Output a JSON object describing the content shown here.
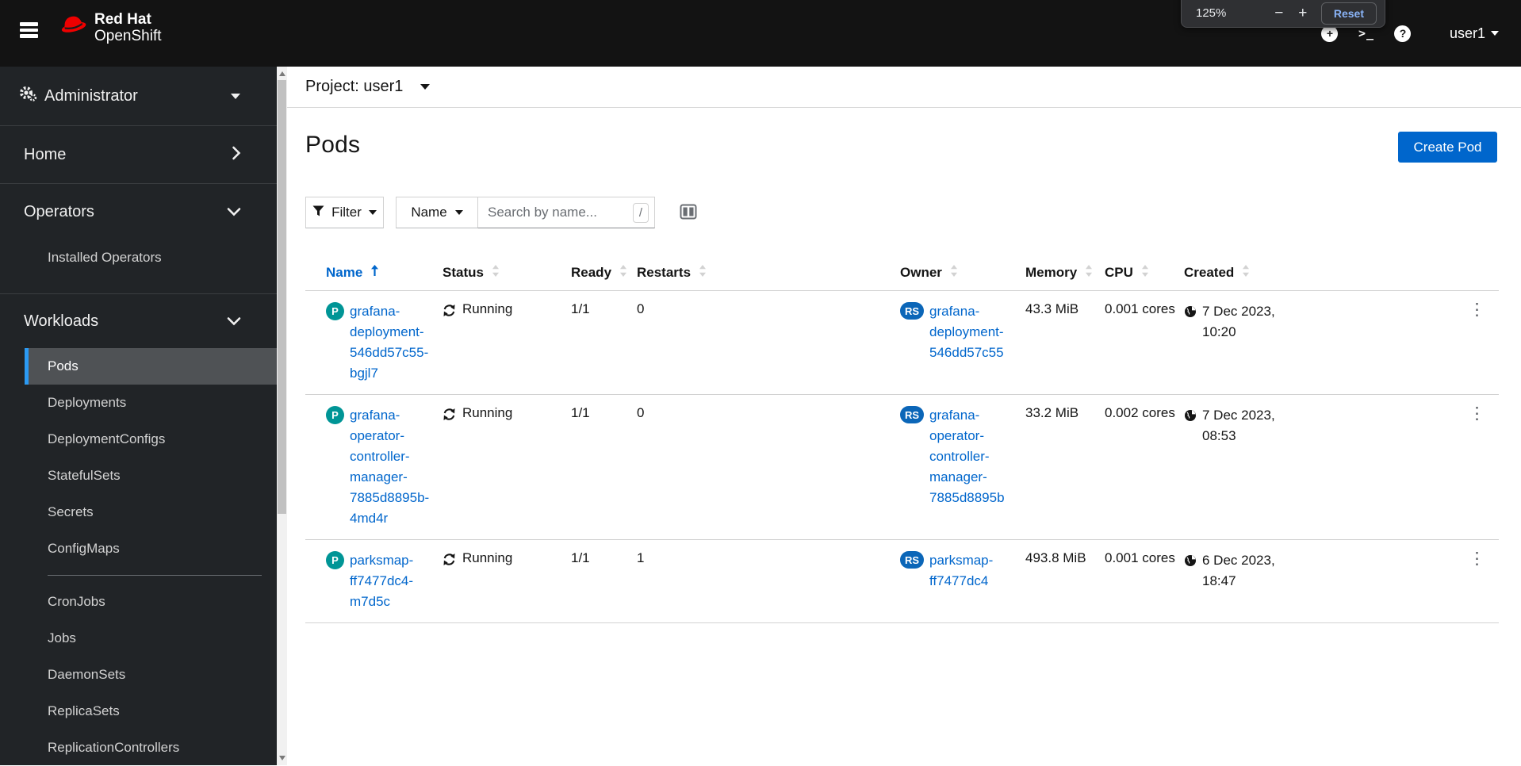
{
  "masthead": {
    "brand": {
      "line1": "Red Hat",
      "line2": "OpenShift"
    },
    "icons": {
      "plus_circle": "+",
      "terminal": ">_",
      "help": "?"
    },
    "user_label": "user1"
  },
  "zoom_overlay": {
    "level": "125%",
    "minus": "−",
    "plus": "+",
    "reset": "Reset"
  },
  "sidebar": {
    "perspective": {
      "label": "Administrator"
    },
    "sections": [
      {
        "label": "Home",
        "expanded": false,
        "items": []
      },
      {
        "label": "Operators",
        "expanded": true,
        "items": [
          {
            "label": "Installed Operators",
            "active": false
          }
        ]
      },
      {
        "label": "Workloads",
        "expanded": true,
        "items": [
          {
            "label": "Pods",
            "active": true
          },
          {
            "label": "Deployments",
            "active": false
          },
          {
            "label": "DeploymentConfigs",
            "active": false
          },
          {
            "label": "StatefulSets",
            "active": false
          },
          {
            "label": "Secrets",
            "active": false
          },
          {
            "label": "ConfigMaps",
            "active": false
          },
          {
            "label": "CronJobs",
            "active": false
          },
          {
            "label": "Jobs",
            "active": false
          },
          {
            "label": "DaemonSets",
            "active": false
          },
          {
            "label": "ReplicaSets",
            "active": false
          },
          {
            "label": "ReplicationControllers",
            "active": false
          }
        ]
      }
    ]
  },
  "project_bar": {
    "label": "Project: user1"
  },
  "page": {
    "title": "Pods",
    "create_button": "Create Pod"
  },
  "toolbar": {
    "filter_label": "Filter",
    "attribute_label": "Name",
    "search_placeholder": "Search by name...",
    "shortcut_hint": "/"
  },
  "table": {
    "columns": [
      {
        "label": "Name",
        "sorted": "asc"
      },
      {
        "label": "Status",
        "sorted": null
      },
      {
        "label": "Ready",
        "sorted": null
      },
      {
        "label": "Restarts",
        "sorted": null
      },
      {
        "label": "Owner",
        "sorted": null
      },
      {
        "label": "Memory",
        "sorted": null
      },
      {
        "label": "CPU",
        "sorted": null
      },
      {
        "label": "Created",
        "sorted": null
      }
    ],
    "rows": [
      {
        "badge": "P",
        "name": "grafana-deployment-546dd57c55-bgjl7",
        "status": "Running",
        "ready": "1/1",
        "restarts": "0",
        "owner_badge": "RS",
        "owner": "grafana-deployment-546dd57c55",
        "memory": "43.3 MiB",
        "cpu": "0.001 cores",
        "created": "7 Dec 2023, 10:20"
      },
      {
        "badge": "P",
        "name": "grafana-operator-controller-manager-7885d8895b-4md4r",
        "status": "Running",
        "ready": "1/1",
        "restarts": "0",
        "owner_badge": "RS",
        "owner": "grafana-operator-controller-manager-7885d8895b",
        "memory": "33.2 MiB",
        "cpu": "0.002 cores",
        "created": "7 Dec 2023, 08:53"
      },
      {
        "badge": "P",
        "name": "parksmap-ff7477dc4-m7d5c",
        "status": "Running",
        "ready": "1/1",
        "restarts": "1",
        "owner_badge": "RS",
        "owner": "parksmap-ff7477dc4",
        "memory": "493.8 MiB",
        "cpu": "0.001 cores",
        "created": "6 Dec 2023, 18:47"
      }
    ]
  },
  "colors": {
    "accent": "#0066cc",
    "masthead_bg": "#131313",
    "sidebar_bg": "#212427",
    "pod_badge": "#009596",
    "rs_badge": "#0b66b8",
    "nav_active_border": "#2b9af3"
  }
}
